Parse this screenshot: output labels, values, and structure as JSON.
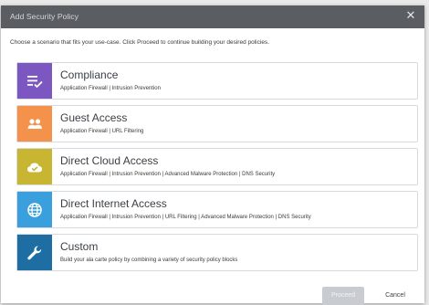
{
  "dialog": {
    "title": "Add Security Policy",
    "instruction": "Choose a scenario that fits your use-case. Click Proceed to continue building your desired policies."
  },
  "options": [
    {
      "title": "Compliance",
      "description": "Application Firewall | Intrusion Prevention",
      "icon": "checklist-icon",
      "color": "#7d57c1"
    },
    {
      "title": "Guest Access",
      "description": "Application Firewall | URL Filtering",
      "icon": "people-icon",
      "color": "#f4914a"
    },
    {
      "title": "Direct Cloud Access",
      "description": "Application Firewall | Intrusion Prevention | Advanced Malware Protection | DNS Security",
      "icon": "cloud-check-icon",
      "color": "#c8b532"
    },
    {
      "title": "Direct Internet Access",
      "description": "Application Firewall | Intrusion Prevention | URL Filtering | Advanced Malware Protection | DNS Security",
      "icon": "globe-icon",
      "color": "#3a9fdd"
    },
    {
      "title": "Custom",
      "description": "Build your ala carte policy by combining a variety of security policy blocks",
      "icon": "wrench-icon",
      "color": "#1e6ea4"
    }
  ],
  "footer": {
    "proceed_label": "Proceed",
    "cancel_label": "Cancel"
  }
}
